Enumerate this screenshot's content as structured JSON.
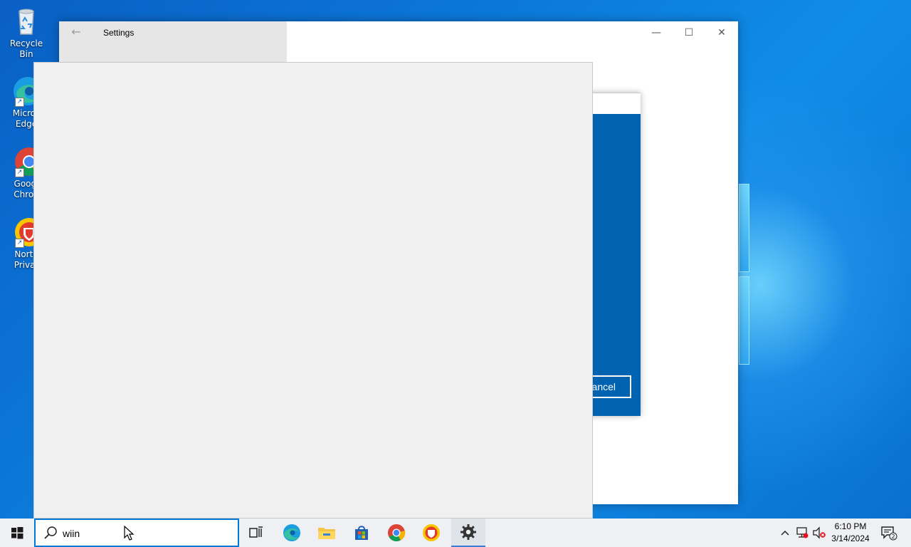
{
  "desktop": {
    "icons": [
      {
        "label": "Recycle Bin",
        "icon": "recycle-bin-icon"
      },
      {
        "label": "Micros\nEdge",
        "icon": "edge-icon"
      },
      {
        "label": "Googl\nChron",
        "icon": "chrome-icon"
      },
      {
        "label": "Norto\nPrivat",
        "icon": "norton-icon"
      }
    ]
  },
  "settings_window": {
    "title": "Settings",
    "back_icon": "back-arrow-icon",
    "minimize_label": "—",
    "maximize_label": "☐",
    "close_label": "✕"
  },
  "dialog": {
    "cancel_label": "ancel"
  },
  "taskbar": {
    "search_value": "wiin",
    "pinned": [
      "task-view-icon",
      "edge-icon",
      "file-explorer-icon",
      "microsoft-store-icon",
      "chrome-icon",
      "norton-icon",
      "settings-gear-icon"
    ],
    "clock_time": "6:10 PM",
    "clock_date": "3/14/2024",
    "notification_count": "2"
  },
  "colors": {
    "accent": "#0078d7",
    "dialog_blue": "#0063b1",
    "taskbar": "#eef0f3"
  }
}
